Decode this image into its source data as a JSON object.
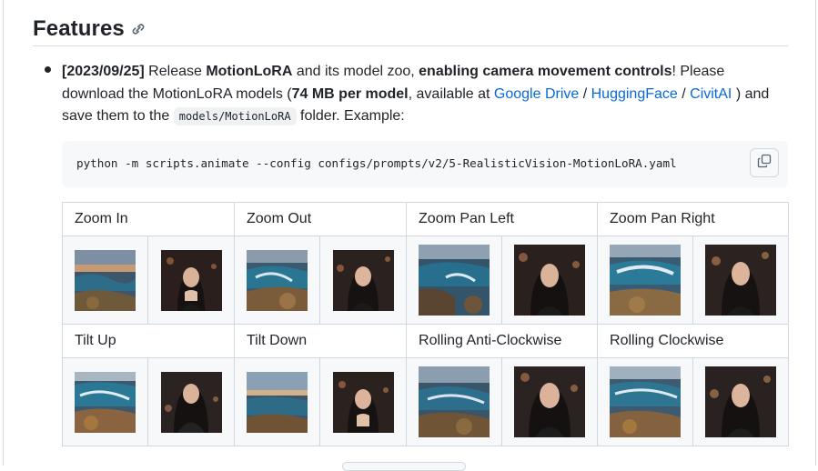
{
  "section": {
    "title": "Features",
    "anchor_icon": "link-icon"
  },
  "release": {
    "date": "[2023/09/25]",
    "t1": " Release ",
    "b1": "MotionLoRA",
    "t2": " and its model zoo, ",
    "b2": "enabling camera movement controls",
    "t3": "! Please download the MotionLoRA models (",
    "b3": "74 MB per model",
    "t4": ", available at ",
    "link1": "Google Drive",
    "sep1": " / ",
    "link2": "HuggingFace",
    "sep2": " / ",
    "link3": "CivitAI",
    "t5": " ) and save them to the ",
    "code": "models/MotionLoRA",
    "t6": " folder. Example:"
  },
  "codeblock": {
    "command": "python -m scripts.animate --config configs/prompts/v2/5-RealisticVision-MotionLoRA.yaml",
    "copy_icon": "copy-icon"
  },
  "table": {
    "row1_labels": [
      "Zoom In",
      "Zoom Out",
      "Zoom Pan Left",
      "Zoom Pan Right"
    ],
    "row2_labels": [
      "Tilt Up",
      "Tilt Down",
      "Rolling Anti-Clockwise",
      "Rolling Clockwise"
    ]
  },
  "colors": {
    "link": "#0969da",
    "text": "#1f2328",
    "border": "#d0d7de",
    "code_bg": "#f6f8fa"
  }
}
